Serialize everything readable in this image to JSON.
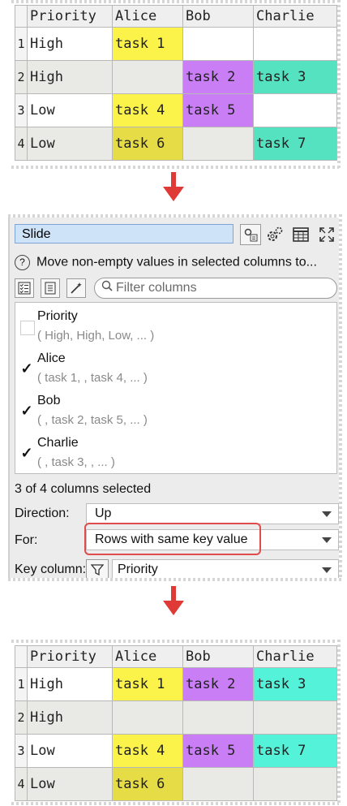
{
  "top_table": {
    "headers": [
      "Priority",
      "Alice",
      "Bob",
      "Charlie"
    ],
    "rows": [
      {
        "num": "1",
        "cells": [
          "High",
          "task 1",
          "",
          ""
        ]
      },
      {
        "num": "2",
        "cells": [
          "High",
          "",
          "task 2",
          "task 3"
        ]
      },
      {
        "num": "3",
        "cells": [
          "Low",
          "task 4",
          "task 5",
          ""
        ]
      },
      {
        "num": "4",
        "cells": [
          "Low",
          "task 6",
          "",
          "task 7"
        ]
      }
    ]
  },
  "panel": {
    "title": "Slide",
    "description": "Move non-empty values in selected columns to...",
    "filter_placeholder": "Filter columns",
    "columns": [
      {
        "name": "Priority",
        "preview": "( High, High, Low, ... )",
        "checked": false
      },
      {
        "name": "Alice",
        "preview": "( task 1, , task 4, ... )",
        "checked": true
      },
      {
        "name": "Bob",
        "preview": "( , task 2, task 5, ... )",
        "checked": true
      },
      {
        "name": "Charlie",
        "preview": "( , task 3, , ... )",
        "checked": true
      }
    ],
    "status": "3 of 4 columns selected",
    "direction_label": "Direction:",
    "direction_value": "Up",
    "for_label": "For:",
    "for_value": "Rows with same key value",
    "key_label": "Key column:",
    "key_value": "Priority",
    "check_mark": "✓"
  },
  "bottom_table": {
    "headers": [
      "Priority",
      "Alice",
      "Bob",
      "Charlie"
    ],
    "rows": [
      {
        "num": "1",
        "cells": [
          "High",
          "task 1",
          "task 2",
          "task 3"
        ]
      },
      {
        "num": "2",
        "cells": [
          "High",
          "",
          "",
          ""
        ]
      },
      {
        "num": "3",
        "cells": [
          "Low",
          "task 4",
          "task 5",
          "task 7"
        ]
      },
      {
        "num": "4",
        "cells": [
          "Low",
          "task 6",
          "",
          ""
        ]
      }
    ]
  },
  "colors": {
    "accent_arrow": "#e03a36",
    "yellow": "#fbf34a",
    "purple": "#c97ef5",
    "green": "#55e2c0",
    "highlight": "#e04b4b"
  },
  "icons": [
    "arrow-down-icon",
    "cog-icon",
    "table-icon",
    "expand-icon",
    "help-icon",
    "check-all-icon",
    "uncheck-icon",
    "wand-icon",
    "search-icon",
    "filter-icon"
  ]
}
